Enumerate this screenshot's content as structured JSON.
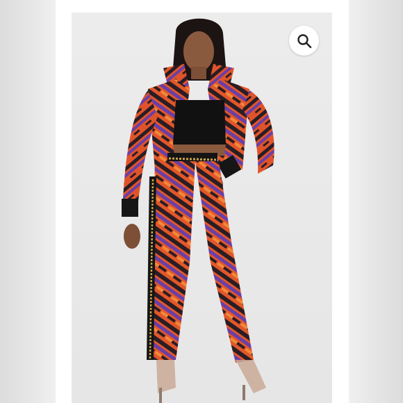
{
  "photo": {
    "description_icon": "model-photo",
    "pattern_colors": [
      "#e2572a",
      "#6a3fa6",
      "#2a1d24",
      "#f08a3a"
    ]
  },
  "zoom": {
    "icon": "magnifier-icon"
  },
  "colors": {
    "background": "#e6e6e6",
    "card": "#ffffff",
    "photo_backdrop": "#e8e8e8"
  }
}
